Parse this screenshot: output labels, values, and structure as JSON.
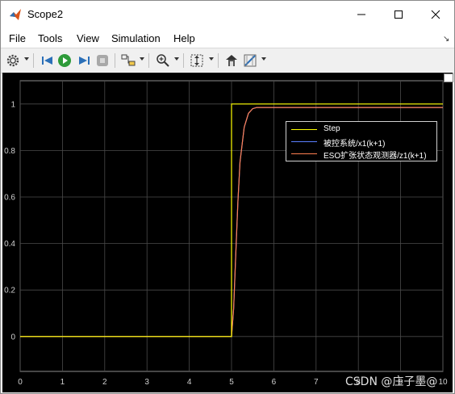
{
  "window": {
    "title": "Scope2",
    "icon": "matlab-icon"
  },
  "menu": {
    "items": [
      "File",
      "Tools",
      "View",
      "Simulation",
      "Help"
    ]
  },
  "toolbar": {
    "icons": [
      "settings-gear-icon",
      "step-back-icon",
      "run-icon",
      "step-forward-icon",
      "stop-icon",
      "highlight-block-icon",
      "zoom-icon",
      "autoscale-icon",
      "triggers-icon",
      "cursor-measurements-icon"
    ]
  },
  "watermark": "CSDN @庄子墨@",
  "chart_data": {
    "type": "line",
    "title": "",
    "xlabel": "",
    "ylabel": "",
    "xlim": [
      0,
      10
    ],
    "ylim": [
      -0.15,
      1.1
    ],
    "xticks": [
      "0",
      "1",
      "2",
      "3",
      "4",
      "5",
      "6",
      "7",
      "8",
      "9",
      "10"
    ],
    "yticks": [
      "0",
      "0.2",
      "0.4",
      "0.6",
      "0.8",
      "1"
    ],
    "grid": true,
    "legend_position": "top-right",
    "series": [
      {
        "name": "Step",
        "color": "#ffff00",
        "x": [
          0,
          5,
          5,
          10
        ],
        "y": [
          0,
          0,
          1,
          1
        ]
      },
      {
        "name": "被控系统/x1(k+1)",
        "color": "#5b7fff",
        "x": [
          0,
          5,
          5.05,
          5.1,
          5.15,
          5.2,
          5.3,
          5.4,
          5.5,
          5.6,
          5.8,
          6.0,
          10
        ],
        "y": [
          0,
          0,
          0.12,
          0.35,
          0.58,
          0.75,
          0.9,
          0.96,
          0.98,
          0.985,
          0.985,
          0.985,
          0.985
        ]
      },
      {
        "name": "ESO扩张状态观测器/z1(k+1)",
        "color": "#ff7f50",
        "x": [
          0,
          5,
          5.05,
          5.1,
          5.15,
          5.2,
          5.3,
          5.4,
          5.5,
          5.6,
          5.8,
          6.0,
          10
        ],
        "y": [
          0,
          0,
          0.12,
          0.35,
          0.58,
          0.75,
          0.9,
          0.96,
          0.98,
          0.985,
          0.985,
          0.985,
          0.985
        ]
      }
    ]
  }
}
